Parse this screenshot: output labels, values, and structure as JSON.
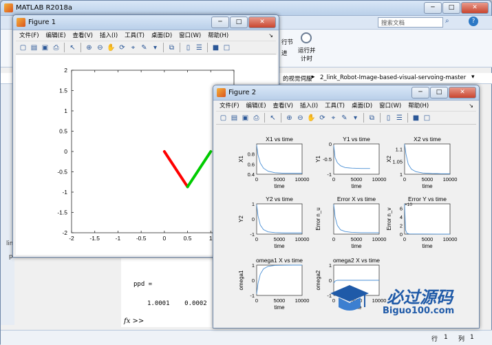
{
  "matlab": {
    "title": "MATLAB R2018a",
    "search_placeholder": "搜索文档",
    "ribbon_run_section": "运行并\n计时",
    "ribbon_run_section_line1": "运行并",
    "ribbon_run_section_line2": "计时",
    "ribbon_node": "行节",
    "ribbon_advance": "进",
    "path_segment1": "的视觉伺服",
    "path_segment2": "2_link_Robot-Image-based-visual-servoing-master",
    "cmd_var": "ppd =",
    "cmd_values": "1.0001    0.0002",
    "cmd_prompt": "fx >>",
    "status_row_label": "行",
    "status_row": "1",
    "status_col_label": "列",
    "status_col": "1",
    "left_stub1": "lin",
    "left_stub2": "p"
  },
  "figure1": {
    "title": "Figure 1",
    "menu": [
      "文件(F)",
      "编辑(E)",
      "查看(V)",
      "插入(I)",
      "工具(T)",
      "桌面(D)",
      "窗口(W)",
      "帮助(H)"
    ],
    "menu_pin": "↘",
    "chart_data": {
      "type": "line",
      "title": "",
      "xlabel": "",
      "ylabel": "",
      "xlim": [
        -2,
        1.5
      ],
      "ylim": [
        -2,
        2
      ],
      "xticks": [
        "-2",
        "-1.5",
        "-1",
        "-0.5",
        "0",
        "0.5",
        "1",
        "1.5"
      ],
      "yticks": [
        "2",
        "1.5",
        "1",
        "0.5",
        "0",
        "-0.5",
        "-1",
        "-1.5",
        "-2"
      ],
      "series": [
        {
          "color": "#ff0000",
          "x": [
            0,
            0.5
          ],
          "y": [
            0,
            -0.87
          ]
        },
        {
          "color": "#00cc00",
          "x": [
            0.5,
            1.0
          ],
          "y": [
            -0.87,
            0.0
          ]
        }
      ]
    }
  },
  "figure2": {
    "title": "Figure 2",
    "menu": [
      "文件(F)",
      "编辑(E)",
      "查看(V)",
      "插入(I)",
      "工具(T)",
      "桌面(D)",
      "窗口(W)",
      "帮助(H)"
    ],
    "menu_pin": "↘",
    "chart_data": [
      {
        "type": "line",
        "title": "X1 vs time",
        "xlabel": "time",
        "ylabel": "X1",
        "xlim": [
          0,
          10000
        ],
        "ylim": [
          0.4,
          1.0
        ],
        "yticks": [
          "0.8",
          "0.6",
          "0.4"
        ],
        "xticks": [
          "0",
          "5000",
          "10000"
        ],
        "series": [
          {
            "color": "#4a8fd4",
            "x": [
              0,
              300,
              800,
              1500,
              2500,
              4000,
              6000,
              8000,
              10000
            ],
            "y": [
              0.98,
              0.78,
              0.62,
              0.52,
              0.46,
              0.43,
              0.42,
              0.42,
              0.42
            ]
          }
        ]
      },
      {
        "type": "line",
        "title": "Y1 vs time",
        "xlabel": "time",
        "ylabel": "Y1",
        "xlim": [
          0,
          10000
        ],
        "ylim": [
          -1.0,
          0.0
        ],
        "yticks": [
          "0",
          "-0.5",
          "-1"
        ],
        "xticks": [
          "0",
          "5000",
          "10000"
        ],
        "series": [
          {
            "color": "#4a8fd4",
            "x": [
              0,
              300,
              800,
              1500,
              2500,
              4000,
              6000,
              8000
            ],
            "y": [
              -0.05,
              -0.45,
              -0.62,
              -0.72,
              -0.78,
              -0.8,
              -0.81,
              -0.81
            ]
          }
        ]
      },
      {
        "type": "line",
        "title": "X2 vs time",
        "xlabel": "time",
        "ylabel": "X2",
        "xlim": [
          0,
          10000
        ],
        "ylim": [
          1.0,
          1.12
        ],
        "yticks": [
          "1.1",
          "1.05",
          "1"
        ],
        "xticks": [
          "0",
          "5000",
          "10000"
        ],
        "series": [
          {
            "color": "#4a8fd4",
            "x": [
              0,
              300,
              800,
              1500,
              2500,
              4000,
              6000,
              8000,
              10000
            ],
            "y": [
              1.12,
              1.08,
              1.04,
              1.02,
              1.01,
              1.005,
              1.003,
              1.002,
              1.002
            ]
          }
        ]
      },
      {
        "type": "line",
        "title": "Y2 vs time",
        "xlabel": "time",
        "ylabel": "Y2",
        "xlim": [
          0,
          10000
        ],
        "ylim": [
          -1.0,
          1.0
        ],
        "yticks": [
          "1",
          "0",
          "-1"
        ],
        "xticks": [
          "0",
          "5000",
          "10000"
        ],
        "series": [
          {
            "color": "#4a8fd4",
            "x": [
              0,
              300,
              800,
              1500,
              2500,
              4000,
              6000,
              8000,
              10000
            ],
            "y": [
              0.95,
              0.2,
              -0.4,
              -0.7,
              -0.85,
              -0.9,
              -0.92,
              -0.92,
              -0.92
            ]
          }
        ]
      },
      {
        "type": "line",
        "title": "Error X vs time",
        "xlabel": "time",
        "ylabel": "Error n_u",
        "xlim": [
          0,
          10000
        ],
        "ylim": [
          -0.05,
          1.0
        ],
        "yticks": [],
        "xticks": [
          "0",
          "5000",
          "10000"
        ],
        "series": [
          {
            "color": "#4a8fd4",
            "x": [
              0,
              300,
              800,
              1500,
              2500,
              4000,
              6000,
              8000,
              10000
            ],
            "y": [
              0.98,
              0.55,
              0.25,
              0.1,
              0.04,
              0.01,
              0.0,
              0.0,
              0.0
            ]
          }
        ]
      },
      {
        "type": "line",
        "title": "Error Y vs time",
        "xlabel": "time",
        "ylabel": "Error n_v",
        "xlim": [
          0,
          10000
        ],
        "ylim": [
          0,
          7
        ],
        "yticks": [
          "6",
          "4",
          "2",
          "0"
        ],
        "xticks": [
          "0",
          "5000",
          "10000"
        ],
        "annotation": "×10",
        "series": [
          {
            "color": "#4a8fd4",
            "x": [
              0,
              200,
              500,
              1000,
              10000
            ],
            "y": [
              7,
              1,
              0.2,
              0.05,
              0.0
            ]
          }
        ]
      },
      {
        "type": "line",
        "title": "omega1 X vs time",
        "xlabel": "time",
        "ylabel": "omega1",
        "xlim": [
          0,
          10000
        ],
        "ylim": [
          -1,
          1
        ],
        "yticks": [
          "1",
          "0",
          "-1"
        ],
        "xticks": [
          "0",
          "5000",
          "10000"
        ],
        "series": [
          {
            "color": "#4a8fd4",
            "x": [
              0,
              300,
              800,
              1500,
              2500,
              4000,
              6000,
              8000,
              10000
            ],
            "y": [
              -0.9,
              -0.2,
              0.4,
              0.75,
              0.92,
              0.98,
              0.99,
              1.0,
              1.0
            ]
          }
        ]
      },
      {
        "type": "line",
        "title": "omega2 X vs time",
        "xlabel": "time",
        "ylabel": "omega2",
        "xlim": [
          0,
          10000
        ],
        "ylim": [
          -1,
          1
        ],
        "yticks": [
          "1",
          "0",
          "-1"
        ],
        "xticks": [
          "0",
          "5000",
          "10000"
        ],
        "series": [
          {
            "color": "#4a8fd4",
            "x": [
              0,
              300,
              800,
              1500,
              2500,
              4000,
              6000,
              8000,
              10000
            ],
            "y": [
              -0.2,
              -0.05,
              0.0,
              0.0,
              0.0,
              0.0,
              0.0,
              0.0,
              0.0
            ]
          }
        ]
      }
    ]
  },
  "watermark": {
    "brand": "必过源码",
    "url": "Biguo100.com"
  }
}
